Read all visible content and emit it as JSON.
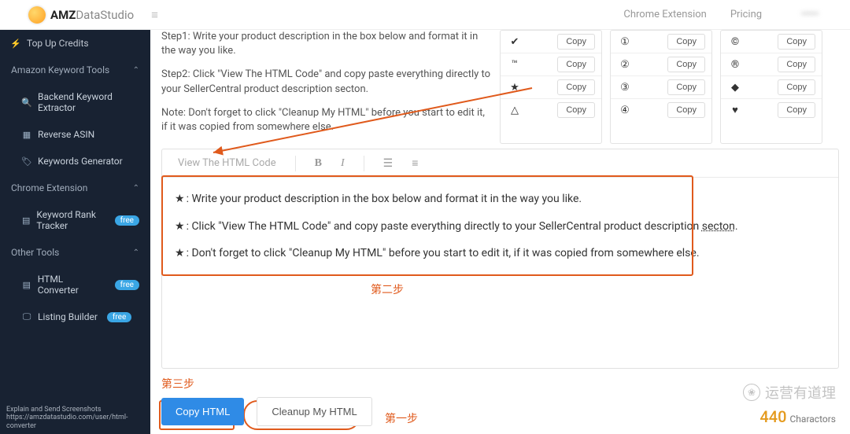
{
  "logo": {
    "main": "AMZ",
    "light": "DataStudio"
  },
  "topnav": {
    "ext": "Chrome Extension",
    "pricing": "Pricing",
    "blur": "•••••"
  },
  "sidebar": {
    "topup": "Top Up Credits",
    "group1": "Amazon Keyword Tools",
    "g1_items": [
      "Backend Keyword Extractor",
      "Reverse ASIN",
      "Keywords Generator"
    ],
    "group2": "Chrome Extension",
    "g2_items": [
      "Keyword Rank Tracker"
    ],
    "group3": "Other Tools",
    "g3_items": [
      "HTML Converter",
      "Listing Builder"
    ],
    "free": "free",
    "foot1": "Explain and Send Screenshots",
    "foot2": "https://amzdatastudio.com/user/html-converter"
  },
  "instructions": {
    "step1": "Step1: Write your product description in the box below and format it in the way you like.",
    "step2": "Step2: Click \"View The HTML Code\" and copy paste everything directly to your SellerCentral product description secton.",
    "note": "Note: Don't forget to click \"Cleanup My HTML\" before you start to edit it, if it was copied from somewhere else."
  },
  "symbols": {
    "col1": [
      "✔",
      "™",
      "★",
      "△"
    ],
    "col2": [
      "①",
      "②",
      "③",
      "④"
    ],
    "col3": [
      "©",
      "®",
      "◆",
      "♥"
    ]
  },
  "copy_label": "Copy",
  "toolbar": {
    "view": "View The HTML Code"
  },
  "editor_lines": [
    "Write your product description in the box below and format it in the way you like.",
    "Click \"View The HTML Code\" and copy paste everything directly to your SellerCentral product description secton.",
    "Don't forget to click \"Cleanup My HTML\" before you start to edit it, if it was copied from somewhere else."
  ],
  "annotations": {
    "step1": "第一步",
    "step2": "第二步",
    "step3": "第三步"
  },
  "buttons": {
    "copy_html": "Copy HTML",
    "cleanup": "Cleanup My HTML"
  },
  "char_count": {
    "num": "440",
    "label": "Charactors"
  },
  "watermark": "运营有道理"
}
